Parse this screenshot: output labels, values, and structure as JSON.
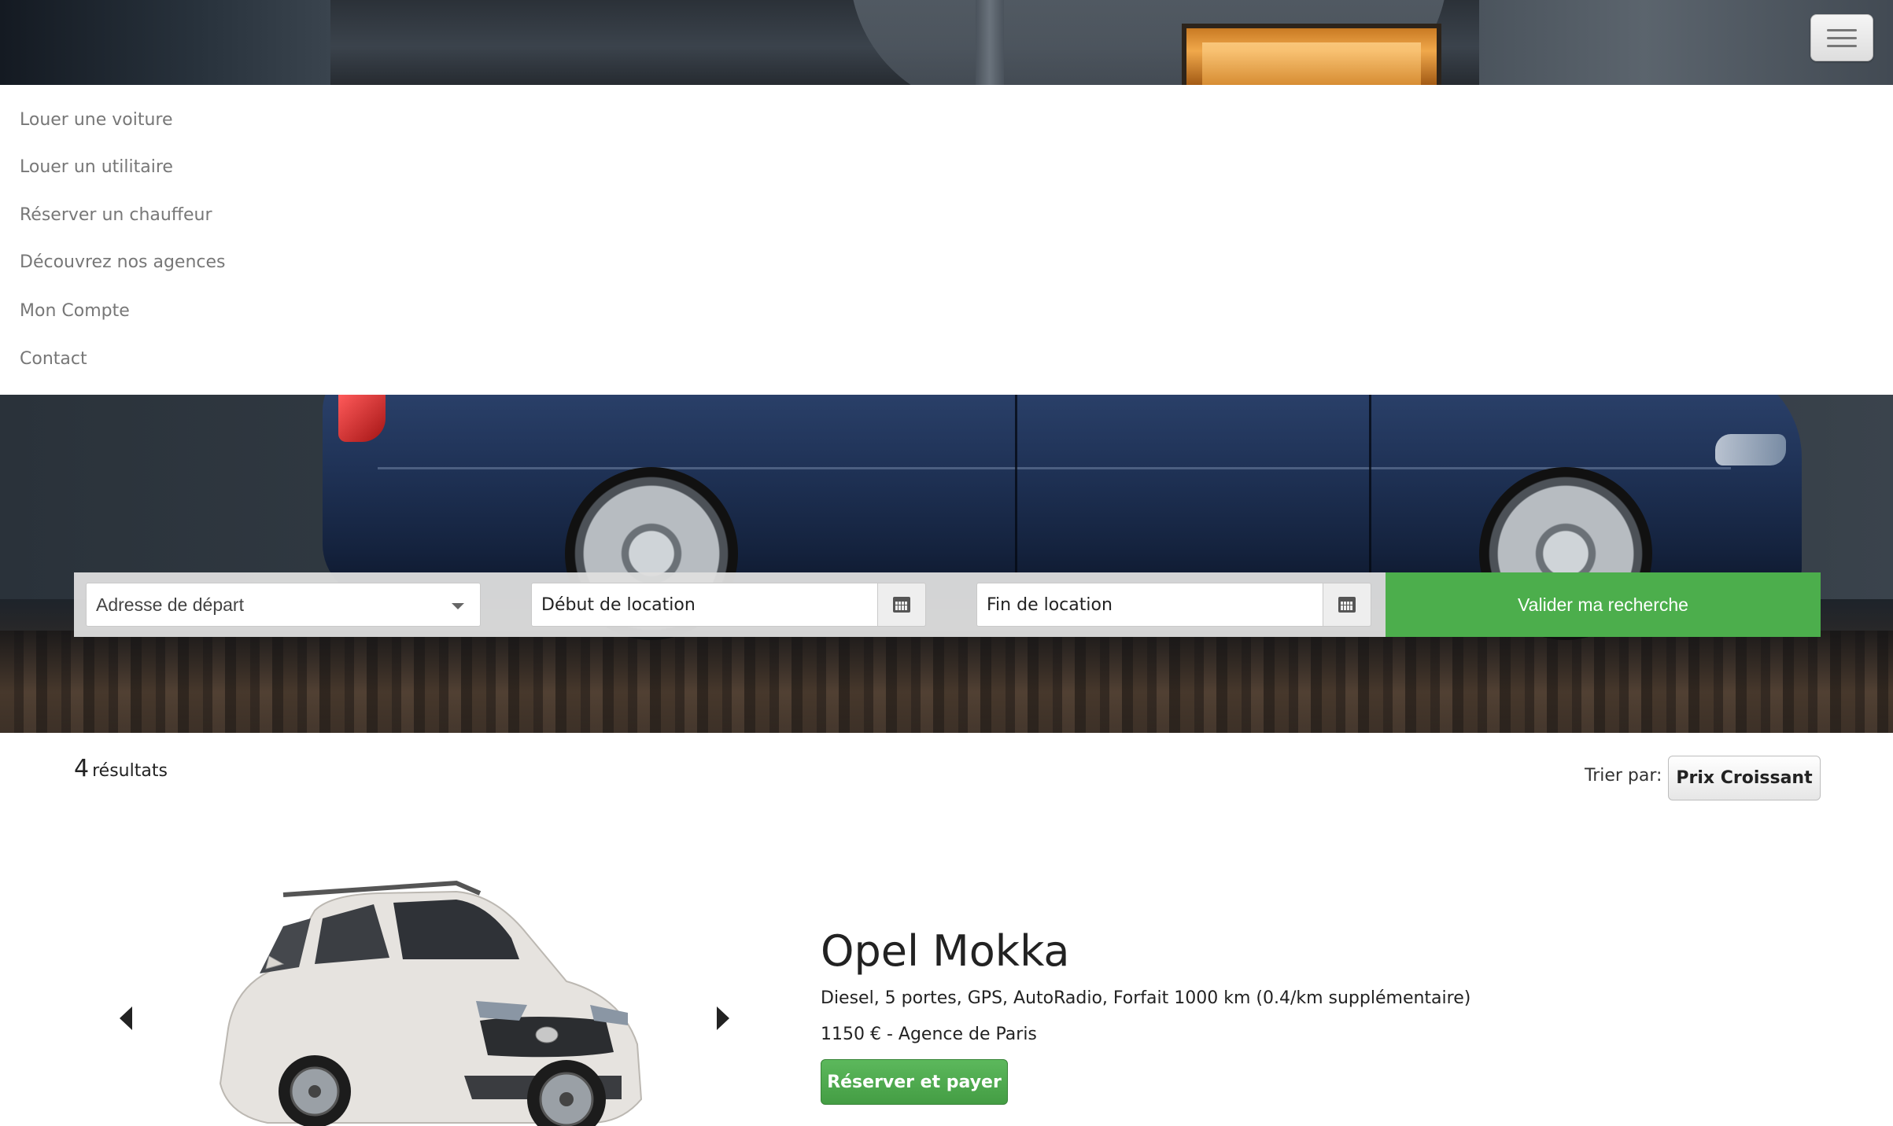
{
  "nav": {
    "items": [
      {
        "label": "Louer une voiture"
      },
      {
        "label": "Louer un utilitaire"
      },
      {
        "label": "Réserver un chauffeur"
      },
      {
        "label": "Découvrez nos agences"
      },
      {
        "label": "Mon Compte"
      },
      {
        "label": "Contact"
      }
    ]
  },
  "search": {
    "departure_placeholder": "Adresse de départ",
    "start_placeholder": "Début de location",
    "end_placeholder": "Fin de location",
    "submit_label": "Valider ma recherche"
  },
  "results": {
    "count": "4",
    "count_label": "résultats",
    "sort_label": "Trier par:",
    "sort_value": "Prix Croissant"
  },
  "car": {
    "name": "Opel Mokka",
    "specs": "Diesel, 5 portes, GPS, AutoRadio, Forfait 1000 km (0.4/km supplémentaire)",
    "price": "1150 € - Agence de Paris",
    "book_label": "Réserver et payer"
  },
  "colors": {
    "accent_green": "#4cae4c",
    "book_green": "#5cb85c",
    "car_body": "#e6e3df"
  }
}
